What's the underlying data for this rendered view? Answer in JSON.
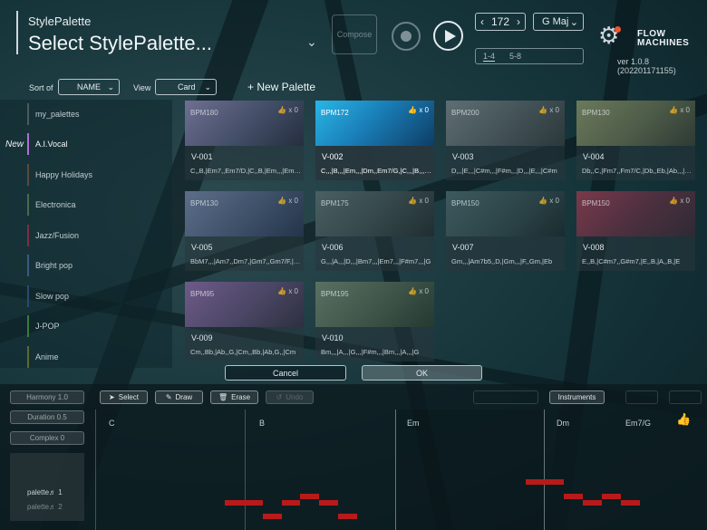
{
  "header": {
    "subtitle": "StylePalette",
    "title": "Select StylePalette...",
    "compose_label": "Compose",
    "tempo": "172",
    "key": "G Maj",
    "bar_ranges": [
      "1-4",
      "5-8"
    ],
    "logo_line1": "FLOW",
    "logo_line2": "MACHINES",
    "version": "ver 1.0.8 (202201171155)"
  },
  "toolbar": {
    "sort_label": "Sort of",
    "sort_value": "NAME",
    "view_label": "View",
    "view_value": "Card",
    "new_palette": "+ New Palette"
  },
  "sidebar": {
    "new_tag": "New",
    "items": [
      {
        "label": "my_palettes",
        "color": "#4a5a5e"
      },
      {
        "label": "A.I.Vocal",
        "color": "#b070d0"
      },
      {
        "label": "Happy Holidays",
        "color": "#5a4a3a"
      },
      {
        "label": "Electronica",
        "color": "#4a6a50"
      },
      {
        "label": "Jazz/Fusion",
        "color": "#7a3040"
      },
      {
        "label": "Bright pop",
        "color": "#3a5a80"
      },
      {
        "label": "Slow pop",
        "color": "#2a4a70"
      },
      {
        "label": "J-POP",
        "color": "#3a7a40"
      },
      {
        "label": "Anime",
        "color": "#5a6a30"
      }
    ]
  },
  "cards": [
    {
      "bpm": "BPM180",
      "likes": "x 0",
      "name": "V-001",
      "chords": "C,,B,|Em7,,Em7/D,|C,,B,|Em,,,|Em7,,Em7/D"
    },
    {
      "bpm": "BPM172",
      "likes": "x 0",
      "name": "V-002",
      "chords": "C,,,|B,,,|Em,,,|Dm,,Em7/G,|C,,,|B,,,|Em"
    },
    {
      "bpm": "BPM200",
      "likes": "x 0",
      "name": "V-003",
      "chords": "D,,,|E,,,|C#m,,,|F#m,,,|D,,,|E,,,|C#m"
    },
    {
      "bpm": "BPM130",
      "likes": "x 0",
      "name": "V-004",
      "chords": "Db,,C,|Fm7,,Fm7/C,|Db,,Eb,|Ab,,,|Db"
    },
    {
      "bpm": "BPM130",
      "likes": "x 0",
      "name": "V-005",
      "chords": "BbM7,,,|Am7,,Dm7,|Gm7,,Gm7/F,|Eb"
    },
    {
      "bpm": "BPM175",
      "likes": "x 0",
      "name": "V-006",
      "chords": "G,,,|A,,,|D,,,|Bm7,,,|Em7,,,|F#m7,,,|G"
    },
    {
      "bpm": "BPM150",
      "likes": "x 0",
      "name": "V-007",
      "chords": "Gm,,,|Am7b5,,D,|Gm,,,|F,,Gm,|Eb"
    },
    {
      "bpm": "BPM150",
      "likes": "x 0",
      "name": "V-008",
      "chords": "E,,B,|C#m7,,G#m7,|E,,B,|A,,B,|E"
    },
    {
      "bpm": "BPM95",
      "likes": "x 0",
      "name": "V-009",
      "chords": "Cm,,Bb,|Ab,,G,|Cm,,Bb,|Ab,G,,|Cm"
    },
    {
      "bpm": "BPM195",
      "likes": "x 0",
      "name": "V-010",
      "chords": "Bm,,,|A,,,|G,,,|F#m,,,|Bm,,,|A,,,|G"
    }
  ],
  "dialog": {
    "cancel": "Cancel",
    "ok": "OK"
  },
  "editor": {
    "harmony": "Harmony 1.0",
    "duration": "Duration 0.5",
    "complex": "Complex 0",
    "select": "Select",
    "draw": "Draw",
    "erase": "Erase",
    "undo": "Undo",
    "instruments": "Instruments",
    "palette1": "palette♬ 1",
    "palette2": "palette♬ 2",
    "chords": [
      "C",
      "B",
      "Em",
      "Dm",
      "Em7/G"
    ]
  }
}
